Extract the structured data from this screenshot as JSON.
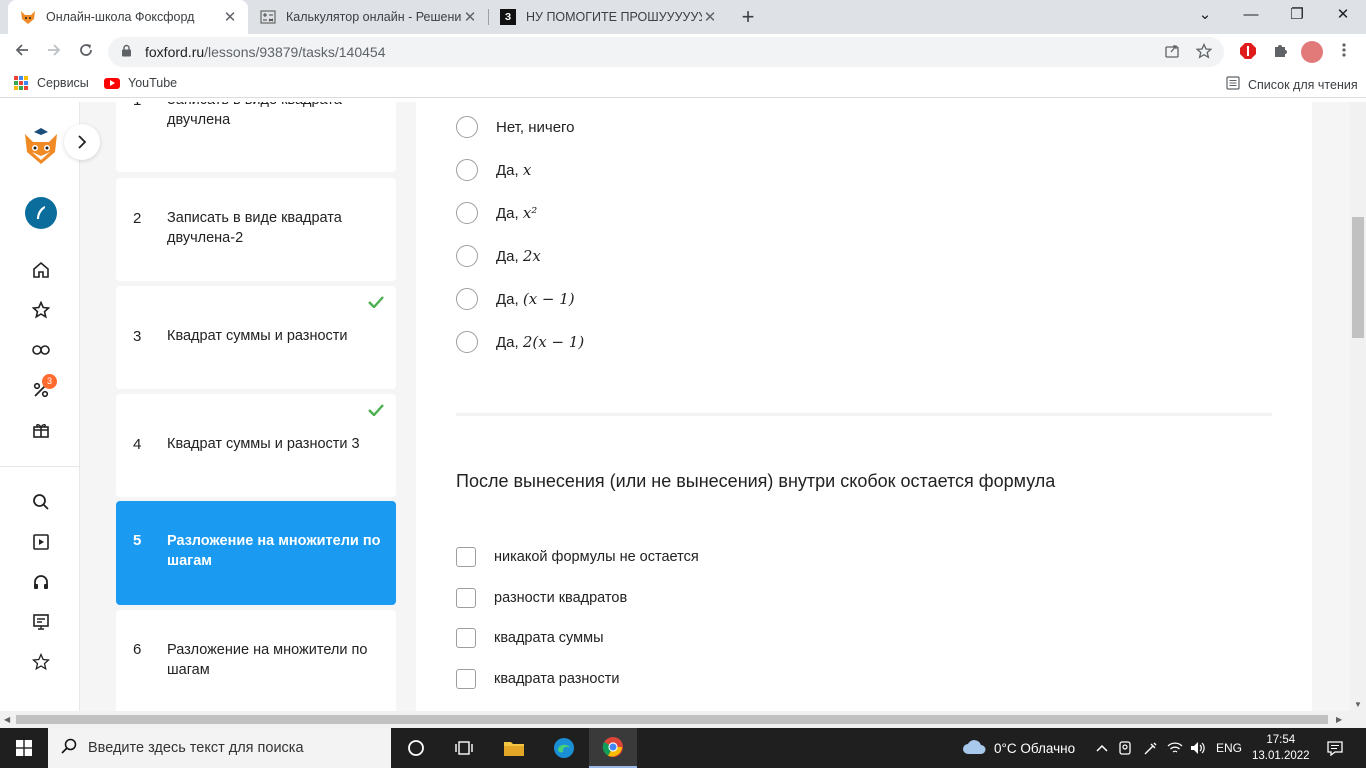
{
  "tabs": [
    {
      "title": "Онлайн-школа Фоксфорд",
      "favicon": "fox-favicon",
      "active": true
    },
    {
      "title": "Калькулятор онлайн - Решение",
      "favicon": "calculator-favicon",
      "active": false
    },
    {
      "title": "НУ ПОМОГИТЕ ПРОШУУУУУУУ",
      "favicon": "znanija-favicon",
      "favicon_text": "З",
      "active": false
    }
  ],
  "tab_close_glyph": "✕",
  "new_tab_glyph": "+",
  "window_controls": {
    "chevron": "⌄",
    "minimize": "—",
    "maximize": "❐",
    "close": "✕"
  },
  "address": {
    "host": "foxford.ru",
    "path": "/lessons/93879/tasks/140454"
  },
  "bookmarks": {
    "apps_label": "Сервисы",
    "youtube_label": "YouTube",
    "reading_list_label": "Список для чтения"
  },
  "rail": {
    "badge_count": "3"
  },
  "tasks": [
    {
      "num": "1",
      "label": "Записать в виде квадрата двучлена",
      "done": false,
      "active": false
    },
    {
      "num": "2",
      "label": "Записать в виде квадрата двучлена-2",
      "done": false,
      "active": false
    },
    {
      "num": "3",
      "label": "Квадрат суммы и разности",
      "done": true,
      "active": false
    },
    {
      "num": "4",
      "label": "Квадрат суммы и разности 3",
      "done": true,
      "active": false
    },
    {
      "num": "5",
      "label": "Разложение на множители по шагам",
      "done": false,
      "active": true
    },
    {
      "num": "6",
      "label": "Разложение на множители по шагам",
      "done": false,
      "active": false
    }
  ],
  "radio_options": [
    {
      "prefix": "Нет, ничего",
      "math": ""
    },
    {
      "prefix": "Да, ",
      "math": "x"
    },
    {
      "prefix": "Да, ",
      "math": "x²"
    },
    {
      "prefix": "Да, ",
      "math": "2x"
    },
    {
      "prefix": "Да, ",
      "math": "(x − 1)"
    },
    {
      "prefix": "Да, ",
      "math": "2(x − 1)"
    }
  ],
  "question": "После вынесения (или не вынесения) внутри скобок остается формула",
  "checkbox_options": [
    "никакой формулы не остается",
    "разности квадратов",
    "квадрата суммы",
    "квадрата разности"
  ],
  "taskbar": {
    "search_placeholder": "Введите здесь текст для поиска",
    "weather": "0°C Облачно",
    "lang": "ENG",
    "time": "17:54",
    "date": "13.01.2022"
  },
  "colors": {
    "accent": "#1a9af0",
    "check": "#4caf50",
    "badge": "#ff6a2f",
    "quill": "#0a6d9c"
  }
}
